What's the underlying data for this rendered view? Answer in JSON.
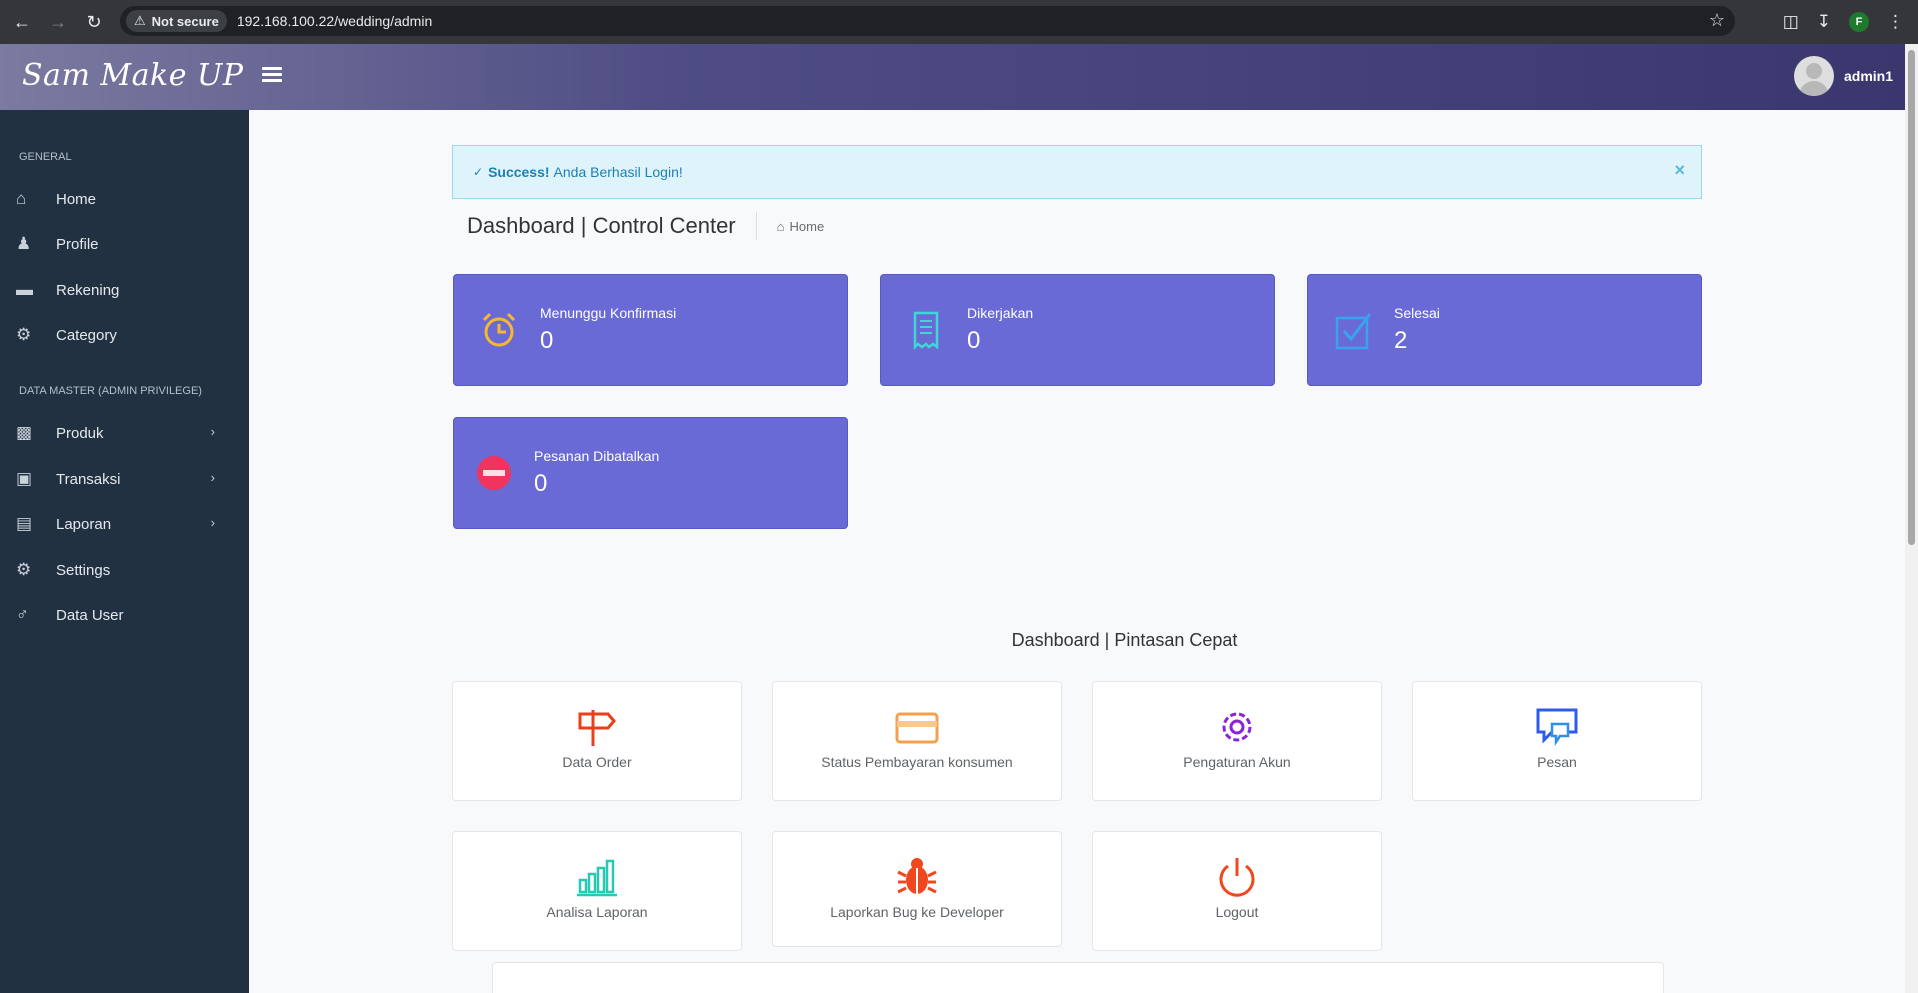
{
  "browser": {
    "security_label": "Not secure",
    "url": "192.168.100.22/wedding/admin",
    "profile_initial": "F"
  },
  "header": {
    "brand": "Sam Make UP",
    "username": "admin1"
  },
  "sidebar": {
    "general_label": "GENERAL",
    "admin_label": "DATA MASTER (ADMIN PRIVILEGE)",
    "items": [
      {
        "label": "Home"
      },
      {
        "label": "Profile"
      },
      {
        "label": "Rekening"
      },
      {
        "label": "Category"
      },
      {
        "label": "Produk"
      },
      {
        "label": "Transaksi"
      },
      {
        "label": "Laporan"
      },
      {
        "label": "Settings"
      },
      {
        "label": "Data User"
      }
    ]
  },
  "alert": {
    "strong": "Success!",
    "message": "Anda Berhasil Login!",
    "close": "×"
  },
  "page": {
    "title": "Dashboard | Control Center",
    "breadcrumb": "Home"
  },
  "stats": [
    {
      "label": "Menunggu Konfirmasi",
      "value": "0",
      "icon": "alarm-clock-icon",
      "icon_color": "#f5b82e"
    },
    {
      "label": "Dikerjakan",
      "value": "0",
      "icon": "receipt-icon",
      "icon_color": "#3fd6d6"
    },
    {
      "label": "Selesai",
      "value": "2",
      "icon": "checkbox-icon",
      "icon_color": "#3aa3f0"
    },
    {
      "label": "Pesanan Dibatalkan",
      "value": "0",
      "icon": "no-entry-icon",
      "icon_color": "#f0345e"
    }
  ],
  "shortcuts": {
    "title": "Dashboard | Pintasan Cepat",
    "items": [
      {
        "label": "Data Order",
        "icon": "signpost-icon"
      },
      {
        "label": "Status Pembayaran konsumen",
        "icon": "credit-card-icon"
      },
      {
        "label": "Pengaturan Akun",
        "icon": "gear-icon"
      },
      {
        "label": "Pesan",
        "icon": "chat-icon"
      },
      {
        "label": "Analisa Laporan",
        "icon": "bar-chart-icon"
      },
      {
        "label": "Laporkan Bug ke Developer",
        "icon": "bug-icon"
      },
      {
        "label": "Logout",
        "icon": "power-icon"
      }
    ]
  },
  "colors": {
    "stat_bg": "#6a6ad6",
    "sidebar_bg": "#223142",
    "alert_text": "#1b81b5"
  }
}
